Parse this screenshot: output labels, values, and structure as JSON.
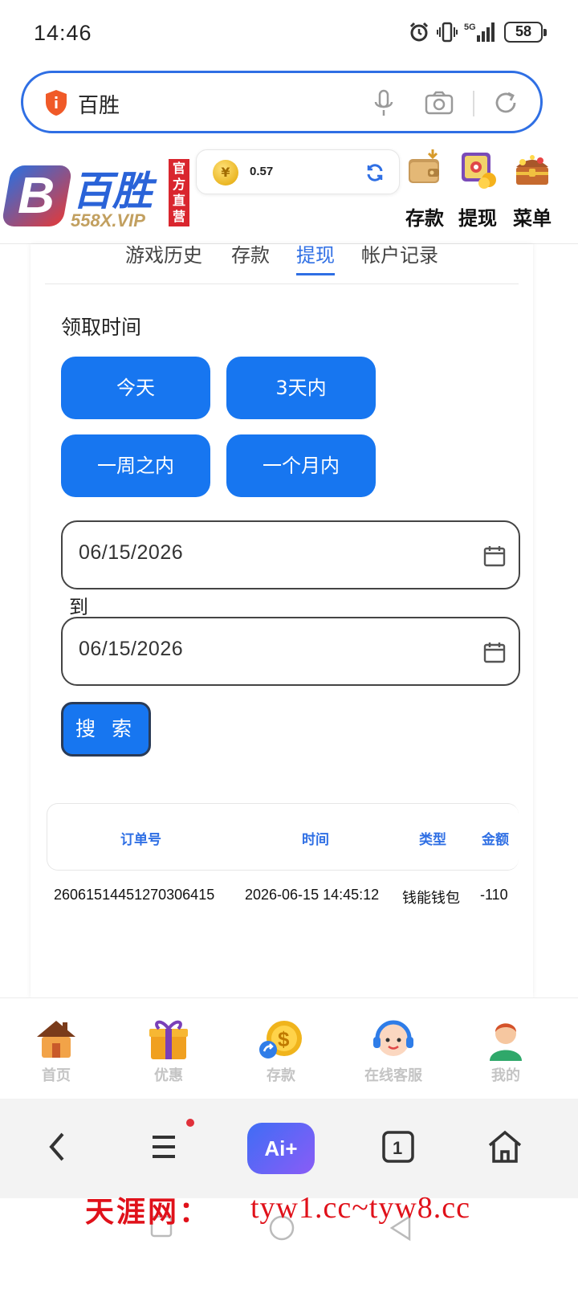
{
  "status_bar": {
    "time": "14:46",
    "battery": "58",
    "network": "5G",
    "icons": [
      "alarm-icon",
      "vibrate-icon",
      "signal-icon",
      "battery-icon"
    ]
  },
  "browser": {
    "search_query": "百胜",
    "icons": [
      "shield-icon",
      "mic-icon",
      "camera-icon",
      "reload-icon"
    ]
  },
  "site_header": {
    "logo_name": "百胜",
    "logo_domain": "558X.VIP",
    "logo_badge": "官方直营",
    "balance": "0.57",
    "actions": [
      {
        "label": "存款",
        "icon": "wallet-icon"
      },
      {
        "label": "提现",
        "icon": "safe-icon"
      },
      {
        "label": "菜单",
        "icon": "treasure-chest-icon"
      }
    ]
  },
  "tabs": [
    {
      "label": "游戏历史",
      "active": false
    },
    {
      "label": "存款",
      "active": false
    },
    {
      "label": "提现",
      "active": true
    },
    {
      "label": "帐户记录",
      "active": false
    }
  ],
  "filter": {
    "label": "领取时间",
    "ranges": [
      "今天",
      "3天内",
      "一周之内",
      "一个月内"
    ],
    "date_from": "06/15/2026",
    "to_label": "到",
    "date_to": "06/15/2026",
    "search_label": "搜 索"
  },
  "table": {
    "columns": [
      "订单号",
      "时间",
      "类型",
      "金额"
    ],
    "rows": [
      [
        "26061514451270306415",
        "2026-06-15 14:45:12",
        "钱能钱包",
        "-110"
      ]
    ]
  },
  "site_nav": [
    {
      "label": "首页",
      "icon": "house-icon"
    },
    {
      "label": "优惠",
      "icon": "gift-icon"
    },
    {
      "label": "存款",
      "icon": "coin-deposit-icon"
    },
    {
      "label": "在线客服",
      "icon": "support-agent-icon"
    },
    {
      "label": "我的",
      "icon": "user-icon"
    }
  ],
  "browser_bar": {
    "ai_label": "Ai+",
    "tab_count": "1",
    "icons": [
      "back-icon",
      "menu-icon",
      "ai-icon",
      "tabs-icon",
      "home-icon"
    ]
  },
  "watermark": {
    "site_name": "天涯网：",
    "urls": "tyw1.cc~tyw8.cc"
  },
  "colors": {
    "accent": "#1776f0",
    "active_tab": "#2f6fe4",
    "watermark": "#e0111a"
  }
}
